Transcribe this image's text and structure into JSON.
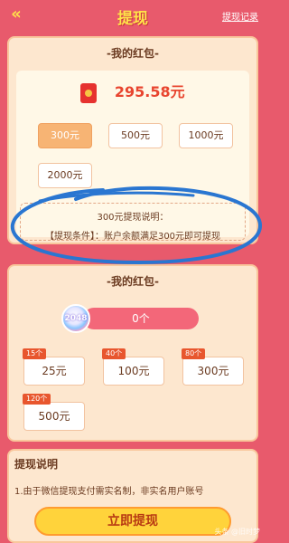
{
  "header": {
    "back_icon": "double-chevron-left-icon",
    "title": "提现",
    "records_link": "提现记录"
  },
  "wallet": {
    "section_title": "-我的红包-",
    "icon": "red-envelope-icon",
    "balance": "295.58元",
    "amount_options": [
      {
        "label": "300元",
        "selected": true
      },
      {
        "label": "500元",
        "selected": false
      },
      {
        "label": "1000元",
        "selected": false
      },
      {
        "label": "2000元",
        "selected": false
      }
    ],
    "note_title": "300元提现说明：",
    "note_text": "【提现条件】：账户余额满足300元即可提现"
  },
  "redpack": {
    "section_title": "-我的红包-",
    "badge": "2048",
    "count": "0个",
    "packs": [
      {
        "tag": "15个",
        "label": "25元"
      },
      {
        "tag": "40个",
        "label": "100元"
      },
      {
        "tag": "80个",
        "label": "300元"
      },
      {
        "tag": "120个",
        "label": "500元"
      }
    ]
  },
  "explain": {
    "title": "提现说明",
    "text": "1.由于微信提现支付需实名制，非实名用户账号"
  },
  "cta": {
    "label": "立即提现"
  },
  "watermark": "头条 @旧时梦"
}
